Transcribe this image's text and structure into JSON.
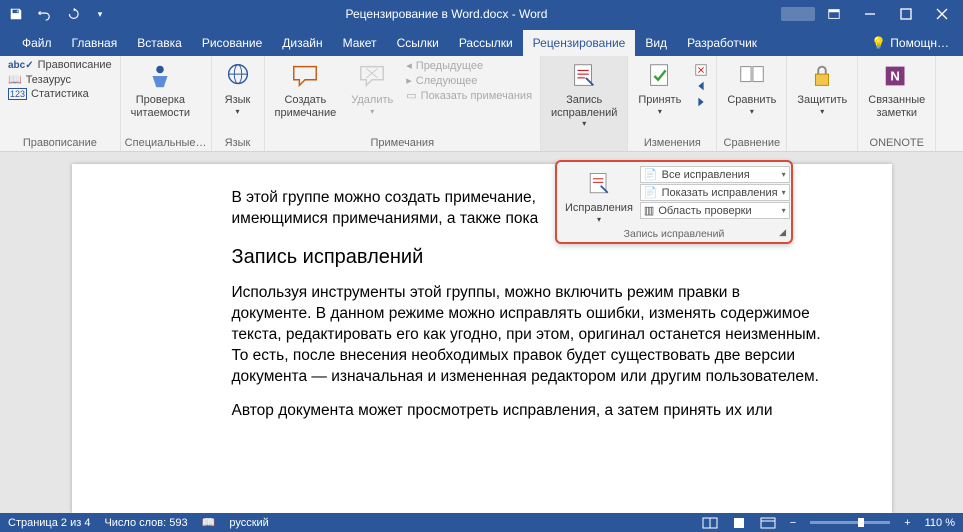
{
  "titlebar": {
    "title": "Рецензирование в Word.docx - Word"
  },
  "tabs": {
    "file": "Файл",
    "home": "Главная",
    "insert": "Вставка",
    "draw": "Рисование",
    "design": "Дизайн",
    "layout": "Макет",
    "refs": "Ссылки",
    "mailings": "Рассылки",
    "review": "Рецензирование",
    "view": "Вид",
    "dev": "Разработчик",
    "help": "Помощн…"
  },
  "ribbon": {
    "g_proofing": {
      "label": "Правописание",
      "spelling": "Правописание",
      "thesaurus": "Тезаурус",
      "stats": "Статистика"
    },
    "g_access": {
      "label": "Специальные…",
      "check": "Проверка\nчитаемости"
    },
    "g_lang": {
      "label": "Язык",
      "btn": "Язык"
    },
    "g_comments": {
      "label": "Примечания",
      "new": "Создать\nпримечание",
      "delete": "Удалить",
      "prev": "Предыдущее",
      "next": "Следующее",
      "show": "Показать примечания"
    },
    "g_track": {
      "label": "Запись\nисправлений"
    },
    "g_changes": {
      "label": "Изменения",
      "accept": "Принять"
    },
    "g_compare": {
      "label": "Сравнение",
      "compare": "Сравнить"
    },
    "g_protect": {
      "label": "Защитить",
      "btn": "Защитить"
    },
    "g_onenote": {
      "label": "ONENOTE",
      "btn": "Связанные\nзаметки"
    }
  },
  "popup": {
    "track": "Исправления",
    "all": "Все исправления",
    "show": "Показать исправления",
    "pane": "Область проверки",
    "label": "Запись исправлений"
  },
  "document": {
    "p1": "В этой группе можно создать примечание,",
    "p2": "имеющимися примечаниями, а также пока",
    "h1": "Запись исправлений",
    "p3": "Используя инструменты этой группы, можно включить режим правки в документе. В данном режиме можно исправлять ошибки, изменять содержимое текста, редактировать его как угодно, при этом, оригинал останется неизменным. То есть, после внесения необходимых правок будет существовать две версии документа — изначальная и измененная редактором или другим пользователем.",
    "p4": "Автор документа может просмотреть исправления, а затем принять их или"
  },
  "status": {
    "page": "Страница 2 из 4",
    "words": "Число слов: 593",
    "lang": "русский",
    "zoom": "110 %"
  }
}
